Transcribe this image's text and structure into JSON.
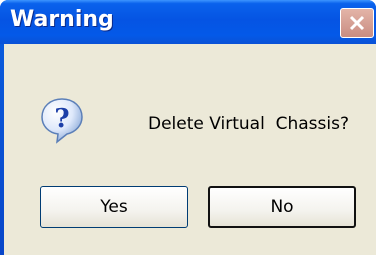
{
  "dialog": {
    "title": "Warning",
    "message": "Delete Virtual  Chassis?",
    "icon": "question-icon",
    "close_icon": "close-icon",
    "buttons": {
      "yes_label": "Yes",
      "no_label": "No"
    }
  },
  "colors": {
    "titlebar": "#0554e3",
    "client_background": "#ece9d8",
    "close_button": "#c98d82"
  }
}
